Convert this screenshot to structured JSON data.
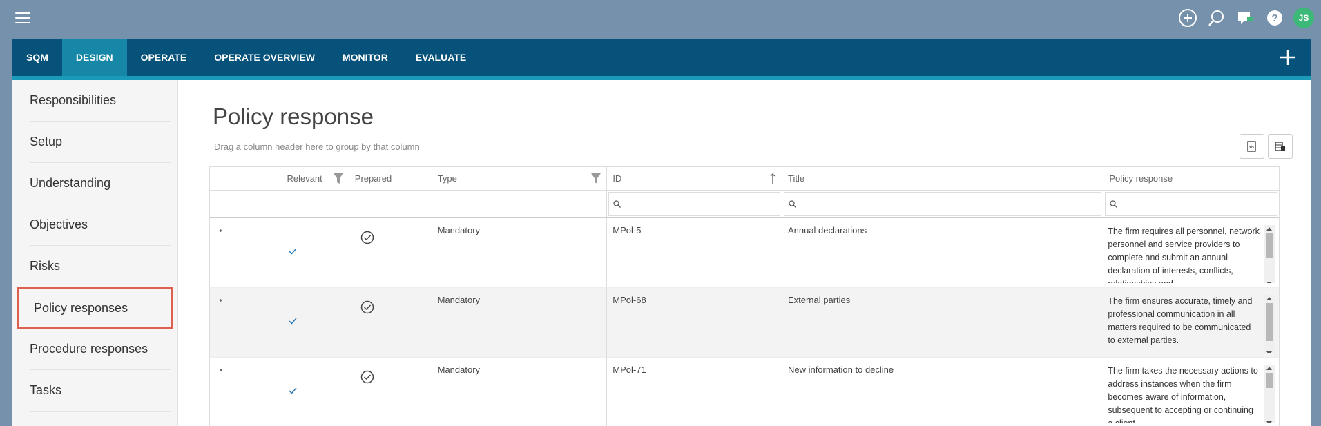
{
  "topbar": {
    "user_initials": "JS",
    "icons": [
      "plus-circle-icon",
      "search-icon",
      "chat-icon",
      "help-icon"
    ]
  },
  "nav": {
    "tabs": [
      {
        "label": "SQM",
        "active": false
      },
      {
        "label": "DESIGN",
        "active": true
      },
      {
        "label": "OPERATE",
        "active": false
      },
      {
        "label": "OPERATE OVERVIEW",
        "active": false
      },
      {
        "label": "MONITOR",
        "active": false
      },
      {
        "label": "EVALUATE",
        "active": false
      }
    ]
  },
  "sidebar": {
    "items": [
      {
        "label": "Responsibilities"
      },
      {
        "label": "Setup"
      },
      {
        "label": "Understanding"
      },
      {
        "label": "Objectives"
      },
      {
        "label": "Risks"
      },
      {
        "label": "Policy responses"
      },
      {
        "label": "Procedure responses"
      },
      {
        "label": "Tasks"
      }
    ],
    "selected_index": 5
  },
  "page": {
    "title": "Policy response",
    "group_hint": "Drag a column header here to group by that column"
  },
  "grid": {
    "columns": [
      "Relevant",
      "Prepared",
      "Type",
      "ID",
      "Title",
      "Policy response"
    ],
    "rows": [
      {
        "relevant": true,
        "prepared": true,
        "type": "Mandatory",
        "id": "MPol-5",
        "title": "Annual declarations",
        "response": "The firm requires all personnel, network personnel and service providers to complete and submit an annual declaration of interests, conflicts, relationships and"
      },
      {
        "relevant": true,
        "prepared": true,
        "type": "Mandatory",
        "id": "MPol-68",
        "title": "External parties",
        "response": "The firm ensures accurate, timely and professional communication in all matters required to be communicated to external parties."
      },
      {
        "relevant": true,
        "prepared": true,
        "type": "Mandatory",
        "id": "MPol-71",
        "title": "New information to decline",
        "response": "The firm takes the necessary actions to address instances when the firm becomes aware of information, subsequent to accepting or continuing a client"
      }
    ]
  }
}
